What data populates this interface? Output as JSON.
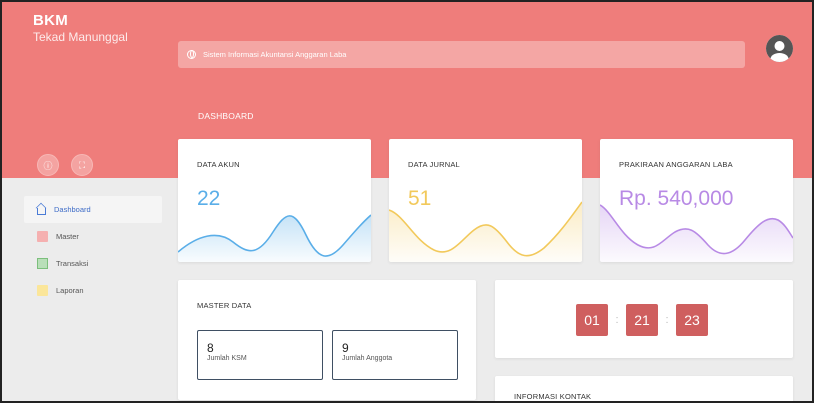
{
  "app": {
    "brand_title": "BKM",
    "brand_subtitle": "Tekad Manunggal"
  },
  "header": {
    "system_title": "Sistem Informasi Akuntansi Anggaran Laba",
    "page_label": "DASHBOARD"
  },
  "sidebar": {
    "quick_buttons": [
      {
        "icon": "info-icon",
        "glyph": "ⓘ"
      },
      {
        "icon": "fullscreen-icon",
        "glyph": "⛶"
      }
    ],
    "items": [
      {
        "label": "Dashboard",
        "icon": "home-icon",
        "active": true
      },
      {
        "label": "Master",
        "icon": "master-icon",
        "active": false
      },
      {
        "label": "Transaksi",
        "icon": "transaction-icon",
        "active": false
      },
      {
        "label": "Laporan",
        "icon": "folder-icon",
        "active": false
      }
    ]
  },
  "stats": [
    {
      "title": "DATA AKUN",
      "value": "22",
      "color": "#5aaee8"
    },
    {
      "title": "DATA JURNAL",
      "value": "51",
      "color": "#f2c95b"
    },
    {
      "title": "PRAKIRAAN ANGGARAN LABA",
      "value": "Rp. 540,000",
      "color": "#b88ae5"
    }
  ],
  "master_data": {
    "title": "MASTER DATA",
    "boxes": [
      {
        "value": "8",
        "label": "Jumlah KSM"
      },
      {
        "value": "9",
        "label": "Jumlah Anggota"
      }
    ]
  },
  "clock": {
    "hours": "01",
    "minutes": "21",
    "seconds": "23",
    "separator": ":"
  },
  "contact": {
    "title": "INFORMASI KONTAK"
  },
  "colors": {
    "header": "#ef7d7b",
    "clock": "#cf5f5f",
    "active_link": "#3e6cc7"
  }
}
